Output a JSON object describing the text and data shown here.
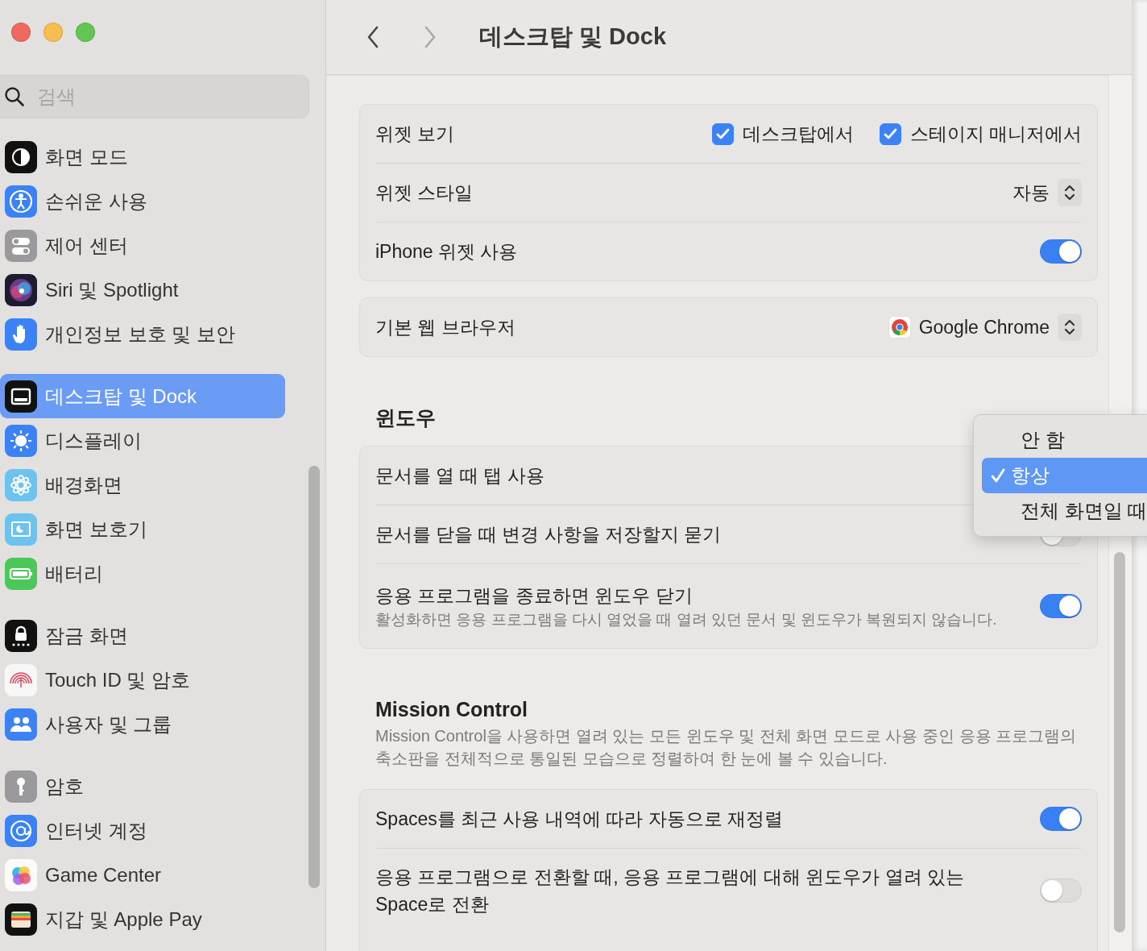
{
  "sidebar": {
    "search": {
      "placeholder": "검색"
    },
    "groups": [
      {
        "items": [
          {
            "label": "화면 모드",
            "selected": false
          },
          {
            "label": "손쉬운 사용",
            "selected": false
          },
          {
            "label": "제어 센터",
            "selected": false
          },
          {
            "label": "Siri 및 Spotlight",
            "selected": false
          },
          {
            "label": "개인정보 보호 및 보안",
            "selected": false
          }
        ]
      },
      {
        "items": [
          {
            "label": "데스크탑 및 Dock",
            "selected": true
          },
          {
            "label": "디스플레이",
            "selected": false
          },
          {
            "label": "배경화면",
            "selected": false
          },
          {
            "label": "화면 보호기",
            "selected": false
          },
          {
            "label": "배터리",
            "selected": false
          }
        ]
      },
      {
        "items": [
          {
            "label": "잠금 화면",
            "selected": false
          },
          {
            "label": "Touch ID 및 암호",
            "selected": false
          },
          {
            "label": "사용자 및 그룹",
            "selected": false
          }
        ]
      },
      {
        "items": [
          {
            "label": "암호",
            "selected": false
          },
          {
            "label": "인터넷 계정",
            "selected": false
          },
          {
            "label": "Game Center",
            "selected": false
          },
          {
            "label": "지갑 및 Apple Pay",
            "selected": false
          }
        ]
      }
    ]
  },
  "toolbar": {
    "title": "데스크탑 및 Dock",
    "nav": [
      {
        "kind": "back",
        "disabled": false
      },
      {
        "kind": "forward",
        "disabled": true
      }
    ]
  },
  "sections": [
    {
      "cards": [
        [
          {
            "kind": "checkboxes",
            "label": "위젯 보기",
            "options": [
              {
                "label": "데스크탑에서",
                "checked": true
              },
              {
                "label": "스테이지 매니저에서",
                "checked": true
              }
            ]
          },
          {
            "kind": "popup",
            "label": "위젯 스타일",
            "value": "자동"
          },
          {
            "kind": "toggle",
            "label": "iPhone 위젯 사용",
            "on": true
          }
        ],
        [
          {
            "kind": "app-popup",
            "label": "기본 웹 브라우저",
            "value": "Google Chrome"
          }
        ]
      ]
    },
    {
      "title": "윈도우",
      "cards": [
        [
          {
            "kind": "menu",
            "label": "문서를 열 때 탭 사용",
            "menu": [
              {
                "label": "안 함",
                "selected": false
              },
              {
                "label": "항상",
                "selected": true
              },
              {
                "label": "전체 화면일 때",
                "selected": false
              }
            ]
          },
          {
            "kind": "toggle",
            "label": "문서를 닫을 때 변경 사항을 저장할지 묻기",
            "on": false
          },
          {
            "kind": "toggle",
            "label": "응용 프로그램을 종료하면 윈도우 닫기",
            "description": "활성화하면 응용 프로그램을 다시 열었을 때 열려 있던 문서 및 윈도우가 복원되지 않습니다.",
            "on": true
          }
        ]
      ]
    },
    {
      "title": "Mission Control",
      "description": "Mission Control을 사용하면 열려 있는 모든 윈도우 및 전체 화면 모드로 사용 중인 응용 프로그램의 축소판을 전체적으로 통일된 모습으로 정렬하여 한 눈에 볼 수 있습니다.",
      "cards": [
        [
          {
            "kind": "toggle",
            "label": "Spaces를 최근 사용 내역에 따라 자동으로 재정렬",
            "on": true
          },
          {
            "kind": "toggle",
            "label": "응용 프로그램으로 전환할 때, 응용 프로그램에 대해 윈도우가 열려 있는 Space로 전환",
            "on": false
          }
        ]
      ]
    }
  ]
}
